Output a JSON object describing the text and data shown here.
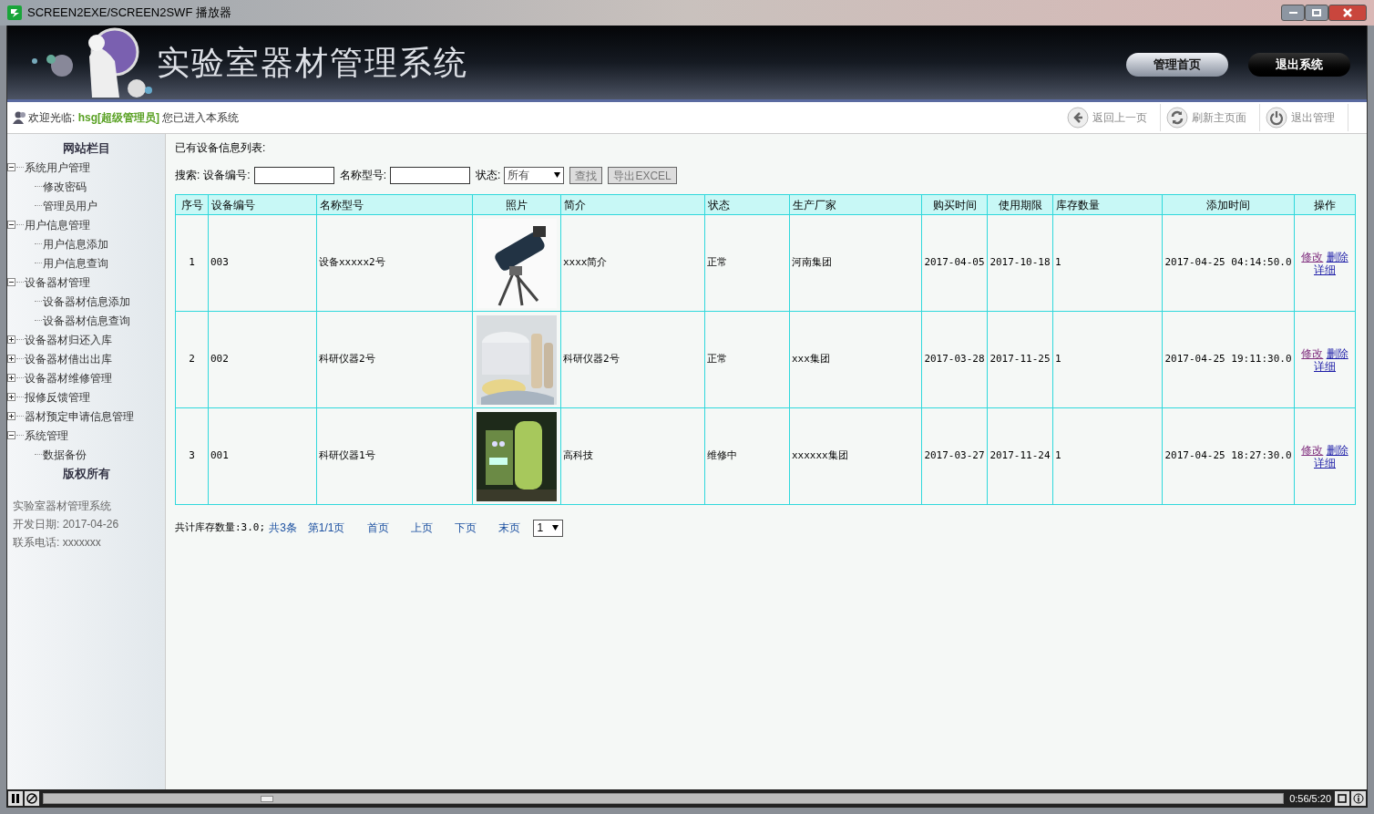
{
  "window": {
    "title": "SCREEN2EXE/SCREEN2SWF 播放器"
  },
  "header": {
    "title": "实验室器材管理系统",
    "buttons": [
      {
        "label": "管理首页",
        "kind": "light"
      },
      {
        "label": "退出系统",
        "kind": "dark"
      }
    ]
  },
  "welcome": {
    "prefix": "欢迎光临:",
    "user": "hsg[超级管理员]",
    "suffix": "您已进入本系统"
  },
  "toolbar": [
    {
      "label": "返回上一页",
      "kind": "back"
    },
    {
      "label": "刷新主页面",
      "kind": "refresh"
    },
    {
      "label": "退出管理",
      "kind": "power"
    }
  ],
  "sidebar": {
    "title": "网站栏目",
    "items": [
      {
        "label": "系统用户管理",
        "expanded": true,
        "children": [
          {
            "label": "修改密码"
          },
          {
            "label": "管理员用户"
          }
        ]
      },
      {
        "label": "用户信息管理",
        "expanded": true,
        "children": [
          {
            "label": "用户信息添加"
          },
          {
            "label": "用户信息查询"
          }
        ]
      },
      {
        "label": "设备器材管理",
        "expanded": true,
        "children": [
          {
            "label": "设备器材信息添加"
          },
          {
            "label": "设备器材信息查询"
          }
        ]
      },
      {
        "label": "设备器材归还入库",
        "expanded": false
      },
      {
        "label": "设备器材借出出库",
        "expanded": false
      },
      {
        "label": "设备器材维修管理",
        "expanded": false
      },
      {
        "label": "报修反馈管理",
        "expanded": false
      },
      {
        "label": "器材预定申请信息管理",
        "expanded": false
      },
      {
        "label": "系统管理",
        "expanded": true,
        "children": [
          {
            "label": "数据备份"
          }
        ]
      }
    ],
    "copyright_title": "版权所有",
    "info": [
      "实验室器材管理系统",
      "开发日期: 2017-04-26",
      "联系电话: xxxxxxx"
    ]
  },
  "content": {
    "heading": "已有设备信息列表:",
    "search": {
      "label": "搜索:",
      "fields": [
        {
          "label": "设备编号:"
        },
        {
          "label": "名称型号:"
        }
      ],
      "status_label": "状态:",
      "status_value": "所有",
      "buttons": [
        "查找",
        "导出EXCEL"
      ]
    },
    "table": {
      "columns": [
        "序号",
        "设备编号",
        "名称型号",
        "照片",
        "简介",
        "状态",
        "生产厂家",
        "购买时间",
        "使用期限",
        "库存数量",
        "添加时间",
        "操作"
      ],
      "rows": [
        {
          "cells": [
            "1",
            "003",
            "设备xxxxx2号",
            {
              "kind": "picture"
            },
            "xxxx简介",
            "正常",
            "河南集团",
            "2017-04-05",
            "2017-10-18",
            "1",
            "2017-04-25 04:14:50.0",
            {
              "actions": [
                "修改",
                "删除",
                "详细"
              ]
            }
          ]
        },
        {
          "cells": [
            "2",
            "002",
            "科研仪器2号",
            {
              "kind": "picture"
            },
            "科研仪器2号",
            "正常",
            "xxx集团",
            "2017-03-28",
            "2017-11-25",
            "1",
            "2017-04-25 19:11:30.0",
            {
              "actions": [
                "修改",
                "删除",
                "详细"
              ]
            }
          ]
        },
        {
          "cells": [
            "3",
            "001",
            "科研仪器1号",
            {
              "kind": "picture"
            },
            "高科技",
            "维修中",
            "xxxxxx集团",
            "2017-03-27",
            "2017-11-24",
            "1",
            "2017-04-25 18:27:30.0",
            {
              "actions": [
                "修改",
                "删除",
                "详细"
              ]
            }
          ]
        }
      ]
    },
    "pager": {
      "total": "共计库存数量:3.0;",
      "links": [
        "共3条",
        "第1/1页",
        "首页",
        "上页",
        "下页",
        "末页"
      ],
      "page_select": "1"
    }
  },
  "player": {
    "time": "0:56/5:20",
    "level": 0.18
  }
}
